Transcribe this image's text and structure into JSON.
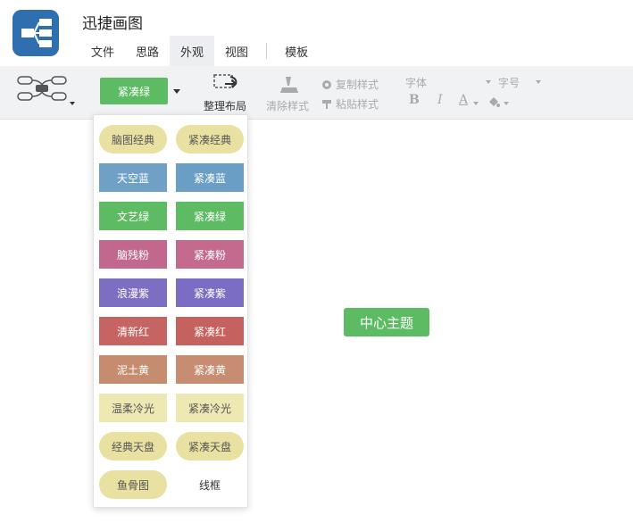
{
  "app": {
    "title": "迅捷画图",
    "icon": "mindmap-app-icon",
    "icon_color": "#2f6fb0"
  },
  "menu": [
    {
      "label": "文件",
      "active": false
    },
    {
      "label": "思路",
      "active": false
    },
    {
      "label": "外观",
      "active": true
    },
    {
      "label": "视图",
      "active": false
    },
    {
      "label": "模板",
      "active": false
    }
  ],
  "toolbar": {
    "structure_icon": "mindmap-structure-icon",
    "theme_button": "紧凑绿",
    "layout_label": "整理布局",
    "clear_style_label": "清除样式",
    "copy_style_label": "复制样式",
    "paste_style_label": "粘贴样式",
    "font_label": "字体",
    "size_label": "字号",
    "bold": "B",
    "italic": "I",
    "font_color": "A"
  },
  "theme_panel": {
    "items": [
      {
        "label": "脑图经典",
        "style": "t-yellow pill"
      },
      {
        "label": "紧凑经典",
        "style": "t-yellow pill"
      },
      {
        "label": "天空蓝",
        "style": "t-sky"
      },
      {
        "label": "紧凑蓝",
        "style": "t-sky2"
      },
      {
        "label": "文艺绿",
        "style": "t-green"
      },
      {
        "label": "紧凑绿",
        "style": "t-green"
      },
      {
        "label": "脑残粉",
        "style": "t-pink"
      },
      {
        "label": "紧凑粉",
        "style": "t-pink2"
      },
      {
        "label": "浪漫紫",
        "style": "t-purple"
      },
      {
        "label": "紧凑紫",
        "style": "t-purple2"
      },
      {
        "label": "清新红",
        "style": "t-red"
      },
      {
        "label": "紧凑红",
        "style": "t-red2"
      },
      {
        "label": "泥土黄",
        "style": "t-earth"
      },
      {
        "label": "紧凑黄",
        "style": "t-earth2"
      },
      {
        "label": "温柔冷光",
        "style": "t-soft"
      },
      {
        "label": "紧凑冷光",
        "style": "t-soft"
      },
      {
        "label": "经典天盘",
        "style": "t-yellow pill"
      },
      {
        "label": "紧凑天盘",
        "style": "t-yellow pill"
      },
      {
        "label": "鱼骨图",
        "style": "t-yellow pill"
      },
      {
        "label": "线框",
        "style": "t-line"
      }
    ]
  },
  "canvas": {
    "center_topic": "中心主题",
    "accent": "#5dbb63"
  }
}
